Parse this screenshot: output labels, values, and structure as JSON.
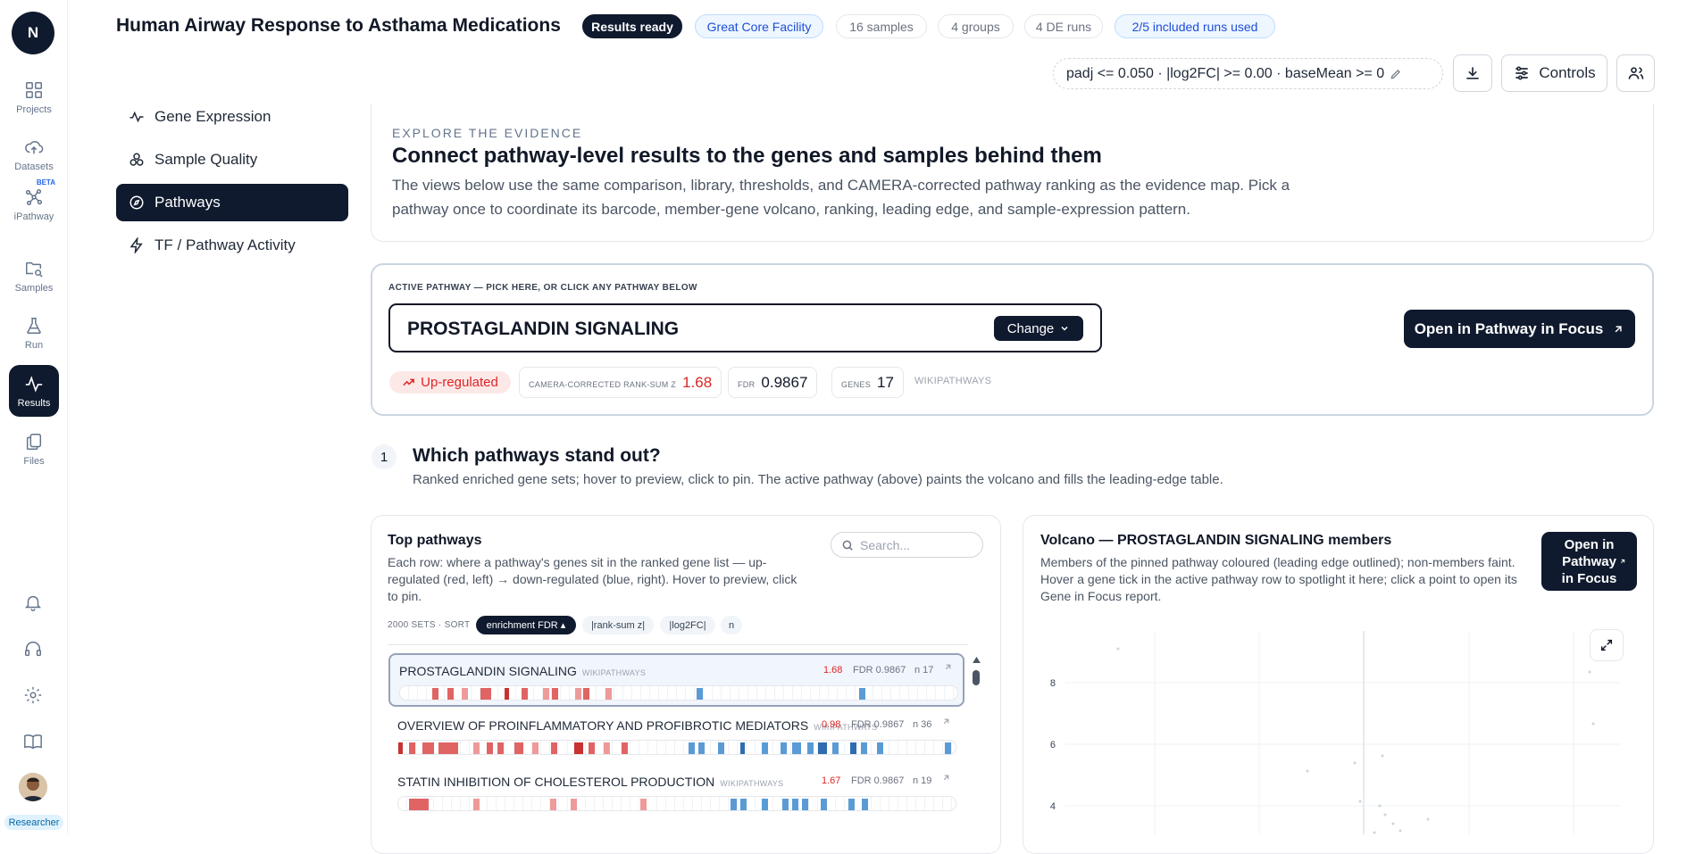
{
  "rail": {
    "logo": "N",
    "items": [
      {
        "label": "Projects",
        "icon": "grid-icon"
      },
      {
        "label": "Datasets",
        "icon": "cloud-upload-icon"
      },
      {
        "label": "iPathway",
        "icon": "network-icon",
        "badge": "BETA"
      },
      {
        "label": "Samples",
        "icon": "folder-search-icon"
      },
      {
        "label": "Run",
        "icon": "flask-icon"
      },
      {
        "label": "Results",
        "icon": "pulse-icon"
      },
      {
        "label": "Files",
        "icon": "files-icon"
      }
    ],
    "role": "Researcher"
  },
  "header": {
    "title": "Human Airway Response to Asthama Medications",
    "chips": [
      "Results ready",
      "Great Core Facility",
      "16 samples",
      "4 groups",
      "4 DE runs",
      "2/5 included runs used"
    ],
    "filter": "padj <= 0.050 · |log2FC| >= 0.00 · baseMean >= 0",
    "controls_label": "Controls"
  },
  "sidebar": {
    "items": [
      "Gene Expression",
      "Sample Quality",
      "Pathways",
      "TF / Pathway Activity"
    ]
  },
  "explore": {
    "eyebrow": "EXPLORE THE EVIDENCE",
    "title": "Connect pathway-level results to the genes and samples behind them",
    "desc": "The views below use the same comparison, library, thresholds, and CAMERA-corrected pathway ranking as the evidence map. Pick a pathway once to coordinate its barcode, member-gene volcano, ranking, leading edge, and sample-expression pattern."
  },
  "active": {
    "label": "ACTIVE PATHWAY — PICK HERE, OR CLICK ANY PATHWAY BELOW",
    "name": "PROSTAGLANDIN SIGNALING",
    "change": "Change",
    "open": "Open in Pathway in Focus",
    "direction": "Up-regulated",
    "z_label": "CAMERA-CORRECTED RANK-SUM Z",
    "z": "1.68",
    "fdr_label": "FDR",
    "fdr": "0.9867",
    "genes_label": "GENES",
    "genes": "17",
    "source": "WIKIPATHWAYS"
  },
  "step": {
    "num": "1",
    "title": "Which pathways stand out?",
    "sub": "Ranked enriched gene sets; hover to preview, click to pin. The active pathway (above) paints the volcano and fills the leading-edge table."
  },
  "top": {
    "title": "Top pathways",
    "desc": "Each row: where a pathway's genes sit in the ranked gene list — up-regulated (red, left) → down-regulated (blue, right). Hover to preview, click to pin.",
    "search_placeholder": "Search...",
    "sort_label": "2000 SETS · SORT",
    "sorts": [
      "enrichment FDR ▴",
      "|rank-sum z|",
      "|log2FC|",
      "n"
    ],
    "rows": [
      {
        "name": "PROSTAGLANDIN SIGNALING",
        "db": "WIKIPATHWAYS",
        "z": "1.68",
        "fdr": "FDR 0.9867",
        "n": "n 17"
      },
      {
        "name": "OVERVIEW OF PROINFLAMMATORY AND PROFIBROTIC MEDIATORS",
        "db": "WIKIPATHWAYS",
        "z": "0.98",
        "fdr": "FDR 0.9867",
        "n": "n 36"
      },
      {
        "name": "STATIN INHIBITION OF CHOLESTEROL PRODUCTION",
        "db": "WIKIPATHWAYS",
        "z": "1.67",
        "fdr": "FDR 0.9867",
        "n": "n 19"
      }
    ]
  },
  "volcano": {
    "title": "Volcano — PROSTAGLANDIN SIGNALING members",
    "desc": "Members of the pinned pathway coloured (leading edge outlined); non-members faint. Hover a gene tick in the active pathway row to spotlight it here; click a point to open its Gene in Focus report.",
    "open": "Open in Pathway in Focus",
    "y_ticks": [
      "8",
      "6",
      "4"
    ]
  }
}
